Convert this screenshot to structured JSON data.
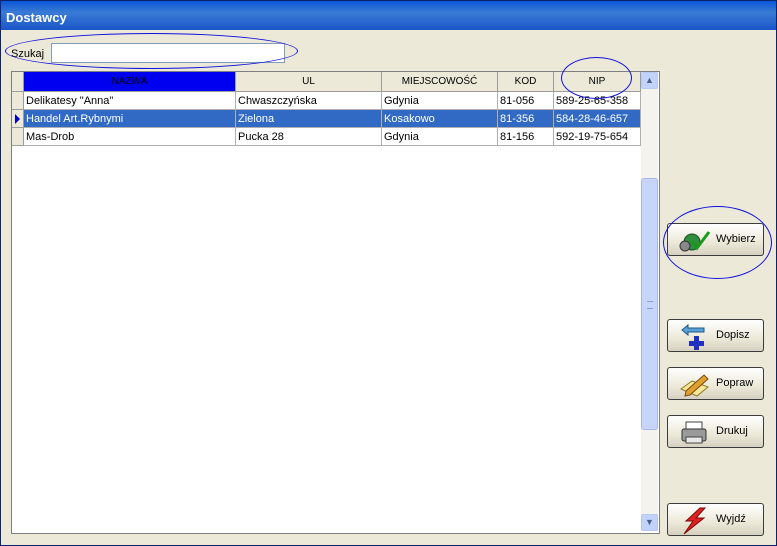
{
  "window": {
    "title": "Dostawcy"
  },
  "search": {
    "label": "Szukaj",
    "value": ""
  },
  "table": {
    "columns": [
      "NAZWA",
      "UL",
      "MIEJSCOWOŚĆ",
      "KOD",
      "NIP"
    ],
    "rows": [
      {
        "nazwa": "Delikatesy \"Anna\"",
        "ul": "Chwaszczyńska",
        "miejscowosc": "Gdynia",
        "kod": "81-056",
        "nip": "589-25-65-358"
      },
      {
        "nazwa": "Handel Art.Rybnymi",
        "ul": "Zielona",
        "miejscowosc": "Kosakowo",
        "kod": "81-356",
        "nip": "584-28-46-657"
      },
      {
        "nazwa": "Mas-Drob",
        "ul": "Pucka 28",
        "miejscowosc": "Gdynia",
        "kod": "81-156",
        "nip": "592-19-75-654"
      }
    ],
    "selected_row": 1
  },
  "buttons": {
    "wybierz": "Wybierz",
    "dopisz": "Dopisz",
    "popraw": "Popraw",
    "drukuj": "Drukuj",
    "wyjdz": "Wyjdź"
  },
  "colors": {
    "selection": "#316ac5",
    "active_header": "#0000f0",
    "annotation": "#1010e0"
  }
}
